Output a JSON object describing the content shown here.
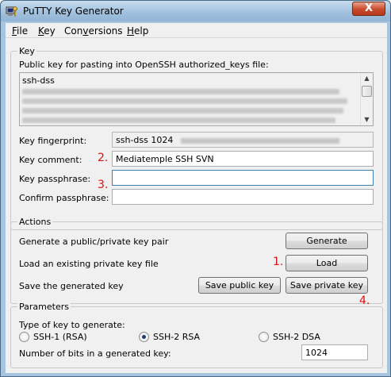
{
  "window": {
    "title": "PuTTY Key Generator",
    "close_symbol": "X"
  },
  "menu": [
    {
      "accel": "F",
      "rest": "ile"
    },
    {
      "accel": "K",
      "rest": "ey"
    },
    {
      "pre": "Con",
      "accel": "v",
      "rest": "ersions"
    },
    {
      "accel": "H",
      "rest": "elp"
    }
  ],
  "key_group": {
    "label": "Key",
    "public_key_label": "Public key for pasting into OpenSSH authorized_keys file:",
    "public_key_first_line": "ssh-dss",
    "fingerprint_label": "Key fingerprint:",
    "fingerprint_value": "ssh-dss 1024",
    "comment_label": "Key comment:",
    "comment_value": "Mediatemple SSH SVN",
    "passphrase_label": "Key passphrase:",
    "passphrase_value": "",
    "confirm_label": "Confirm passphrase:",
    "confirm_value": ""
  },
  "actions_group": {
    "label": "Actions",
    "generate_label": "Generate a public/private key pair",
    "generate_button": "Generate",
    "load_label": "Load an existing private key file",
    "load_button": "Load",
    "save_label": "Save the generated key",
    "save_public_button": "Save public key",
    "save_private_button": "Save private key"
  },
  "params_group": {
    "label": "Parameters",
    "type_label": "Type of key to generate:",
    "options": [
      "SSH-1 (RSA)",
      "SSH-2 RSA",
      "SSH-2 DSA"
    ],
    "selected": "SSH-2 RSA",
    "bits_label": "Number of bits in a generated key:",
    "bits_value": "1024"
  },
  "annotations": [
    "1.",
    "2.",
    "3.",
    "4."
  ],
  "colors": {
    "annotation": "#e01010",
    "title_bar": "#a8c3dc",
    "close_button": "#c84a2c"
  }
}
